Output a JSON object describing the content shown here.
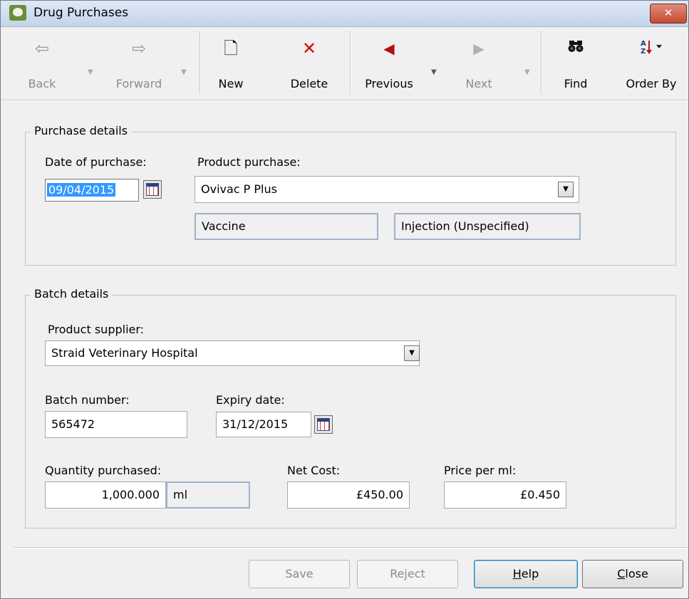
{
  "window": {
    "title": "Drug Purchases",
    "close_glyph": "✕"
  },
  "toolbar": {
    "back": {
      "label": "Back",
      "icon": "⇦",
      "enabled": false
    },
    "forward": {
      "label": "Forward",
      "icon": "⇨",
      "enabled": false
    },
    "new": {
      "label": "New",
      "icon": "🗋",
      "enabled": true
    },
    "delete": {
      "label": "Delete",
      "icon": "✕",
      "enabled": true
    },
    "previous": {
      "label": "Previous",
      "icon": "◀",
      "enabled": true
    },
    "next": {
      "label": "Next",
      "icon": "▶",
      "enabled": false
    },
    "find": {
      "label": "Find",
      "icon": "binoculars-icon",
      "enabled": true
    },
    "order_by": {
      "label": "Order By",
      "icon": "sort-az-icon",
      "enabled": true
    }
  },
  "purchase_details": {
    "legend": "Purchase details",
    "date_label": "Date of purchase:",
    "date_value": "09/04/2015",
    "product_label": "Product purchase:",
    "product_value": "Ovivac P Plus",
    "product_type": "Vaccine",
    "product_route": "Injection (Unspecified)"
  },
  "batch_details": {
    "legend": "Batch details",
    "supplier_label": "Product supplier:",
    "supplier_value": "Straid Veterinary Hospital",
    "batch_label": "Batch number:",
    "batch_value": "565472",
    "expiry_label": "Expiry date:",
    "expiry_value": "31/12/2015",
    "quantity_label": "Quantity purchased:",
    "quantity_value": "1,000.000",
    "quantity_unit": "ml",
    "net_cost_label": "Net Cost:",
    "net_cost_value": "£450.00",
    "price_label": "Price per ml:",
    "price_value": "£0.450"
  },
  "buttons": {
    "save": {
      "label": "Save",
      "enabled": false
    },
    "reject": {
      "label": "Reject",
      "enabled": false
    },
    "help": {
      "label": "Help",
      "mnemonic": "H",
      "rest": "elp",
      "enabled": true
    },
    "close": {
      "label": "Close",
      "mnemonic": "C",
      "rest": "lose",
      "enabled": true
    }
  },
  "colors": {
    "selection": "#3399ff",
    "delete_icon": "#e00000",
    "previous_icon": "#b01010"
  }
}
